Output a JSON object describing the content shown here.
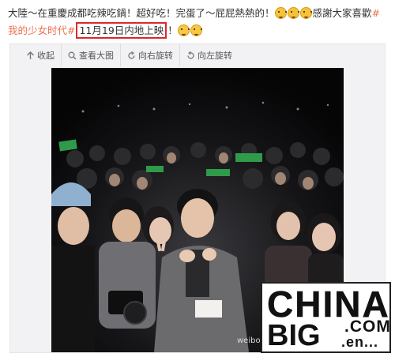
{
  "post": {
    "text_part1": "大陸～在重慶成都吃辣吃鍋！超好吃！完蛋了～屁屁熱熱的！",
    "text_part2": "感謝大家喜歡",
    "hashtag_start": "#我的少女时代#",
    "boxed_text": "11月19日内地上映",
    "text_part3": "！",
    "emojis_mid": [
      "laugh-cry-emoji",
      "laugh-cry-emoji",
      "laugh-cry-emoji"
    ],
    "emojis_end": [
      "smirk-emoji",
      "smirk-emoji"
    ]
  },
  "toolbar": {
    "collapse_label": "收起",
    "view_large_label": "查看大图",
    "rotate_right_label": "向右旋转",
    "rotate_left_label": "向左旋转"
  },
  "watermark": {
    "line1": "CHINA",
    "line2": "BIG",
    "line3": ".COM",
    "line4": ".en..."
  },
  "photo_caption": "weibo",
  "colors": {
    "hashtag": "#eb7350",
    "highlight_box": "#e0262a",
    "photo_bg": "#0b0b0d"
  }
}
